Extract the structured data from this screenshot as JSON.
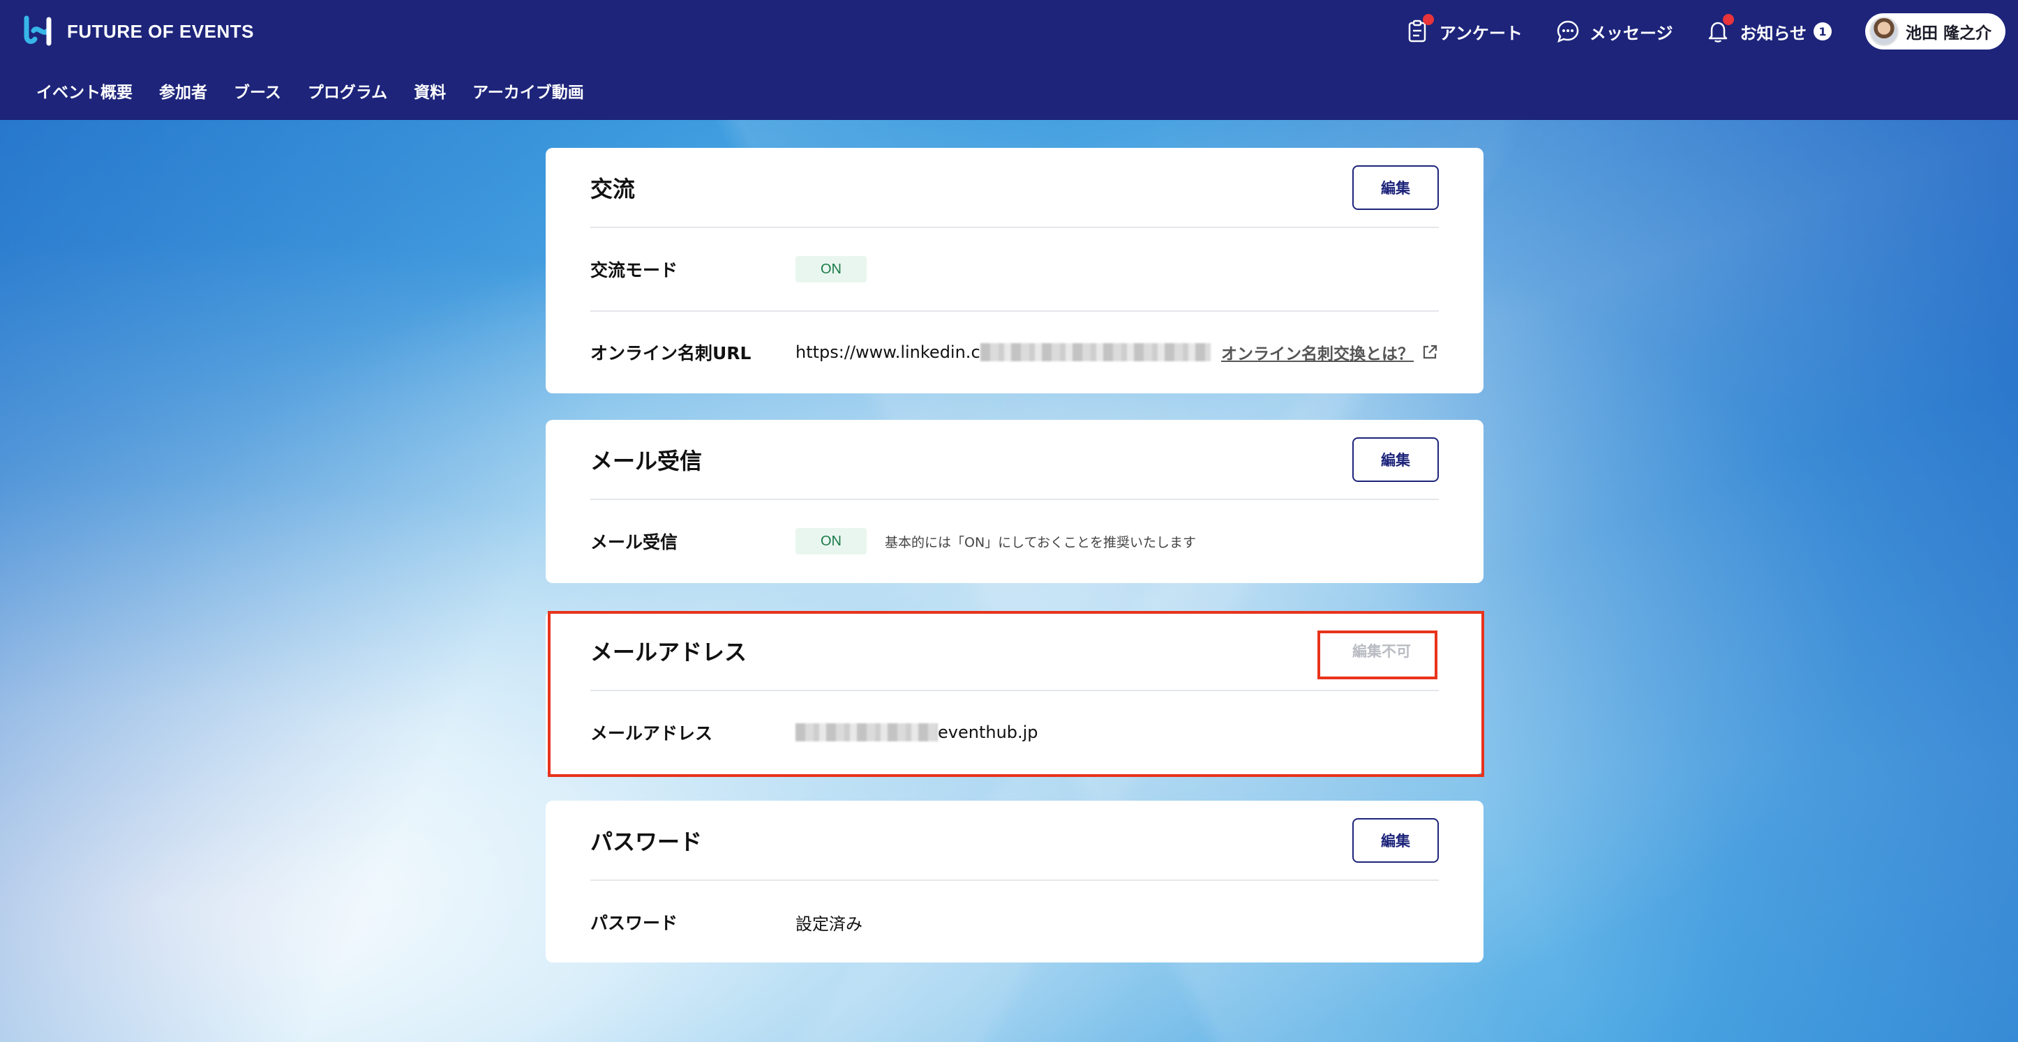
{
  "header": {
    "brand": "FUTURE OF EVENTS",
    "survey_label": "アンケート",
    "messages_label": "メッセージ",
    "notifications_label": "お知らせ",
    "notifications_count": "1",
    "user_name": "池田 隆之介",
    "colors": {
      "bar": "#1d247a",
      "alert_dot": "#e8343a"
    }
  },
  "nav": {
    "items": [
      "イベント概要",
      "参加者",
      "ブース",
      "プログラム",
      "資料",
      "アーカイブ動画"
    ]
  },
  "cards": {
    "exchange": {
      "title": "交流",
      "edit_label": "編集",
      "mode_label": "交流モード",
      "mode_value": "ON",
      "url_label": "オンライン名刺URL",
      "url_value": "https://www.linkedin.c",
      "url_link": "オンライン名刺交換とは？"
    },
    "mail_receive": {
      "title": "メール受信",
      "edit_label": "編集",
      "row_label": "メール受信",
      "row_value": "ON",
      "hint": "基本的には「ON」にしておくことを推奨いたします"
    },
    "mail_address": {
      "title": "メールアドレス",
      "edit_label": "編集不可",
      "row_label": "メールアドレス",
      "row_value_suffix": "eventhub.jp"
    },
    "password": {
      "title": "パスワード",
      "edit_label": "編集",
      "row_label": "パスワード",
      "row_value": "設定済み"
    }
  },
  "highlight_color": "#e8331c"
}
